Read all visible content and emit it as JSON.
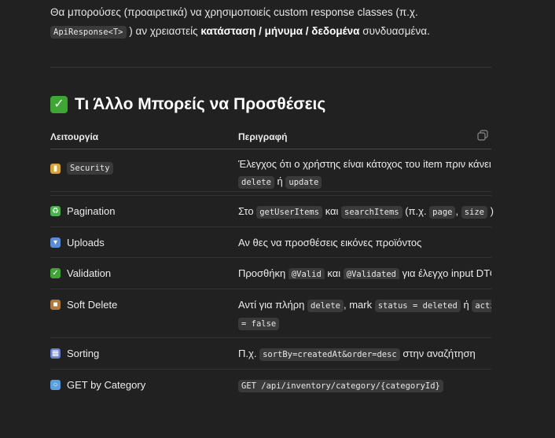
{
  "intro": {
    "t1": "Θα μπορούσες (προαιρετικά) να χρησιμοποιείς custom response classes (π.χ.",
    "code": "ApiResponse<T>",
    "t2": " ) αν χρειαστείς ",
    "bold": "κατάσταση / μήνυμα / δεδομένα",
    "t3": " συνδυασμένα."
  },
  "heading": {
    "icon": "check-mark-button-icon",
    "text": "Τι Άλλο Μπορείς να Προσθέσεις"
  },
  "table": {
    "headers": [
      "Λειτουργία",
      "Περιγραφή"
    ],
    "copy_icon": "copy-icon",
    "rows": [
      {
        "icon": "lock-icon",
        "icon_color": "#d6a43a",
        "icon_glyph": "▮",
        "feature_code": "Security",
        "desc": {
          "t1": "Έλεγχος ότι ο χρήστης είναι κάτοχος του item πριν κάνει",
          "code1": "delete",
          "t2": " ή ",
          "code2": "update"
        }
      },
      {
        "icon": "recycle-icon",
        "icon_color": "#4caf50",
        "icon_glyph": "♻",
        "feature": "Pagination",
        "desc": {
          "t1": "Στο ",
          "code1": "getUserItems",
          "t2": " και ",
          "code2": "searchItems",
          "t3": " (π.χ. ",
          "code3": "page",
          "t4": ", ",
          "code4": "size",
          "t5": " )"
        }
      },
      {
        "icon": "inbox-tray-icon",
        "icon_color": "#5b8dd6",
        "icon_glyph": "▾",
        "feature": "Uploads",
        "desc": {
          "t1": "Αν θες να προσθέσεις εικόνες προϊόντος"
        }
      },
      {
        "icon": "check-mark-button-icon",
        "icon_color": "#3fa535",
        "icon_glyph": "✓",
        "feature": "Validation",
        "desc": {
          "t1": "Προσθήκη ",
          "code1": "@Valid",
          "t2": " και ",
          "code2": "@Validated",
          "t3": " για έλεγχο input DTO"
        }
      },
      {
        "icon": "package-icon",
        "icon_color": "#b07a3c",
        "icon_glyph": "■",
        "feature": "Soft Delete",
        "desc": {
          "t1": "Αντί για πλήρη ",
          "code1": "delete",
          "t2": ", mark ",
          "code2": "status = deleted",
          "t3": " ή ",
          "code3": "active",
          "code4": "= false"
        }
      },
      {
        "icon": "calendar-icon",
        "icon_color": "#6a7fd0",
        "icon_glyph": "▦",
        "feature": "Sorting",
        "desc": {
          "t1": "Π.χ. ",
          "code1": "sortBy=createdAt&order=desc",
          "t2": " στην αναζήτηση"
        }
      },
      {
        "icon": "magnifying-glass-icon",
        "icon_color": "#5aa0e0",
        "icon_glyph": "○",
        "feature": "GET by Category",
        "desc": {
          "code1": "GET /api/inventory/category/{categoryId}"
        }
      }
    ]
  }
}
